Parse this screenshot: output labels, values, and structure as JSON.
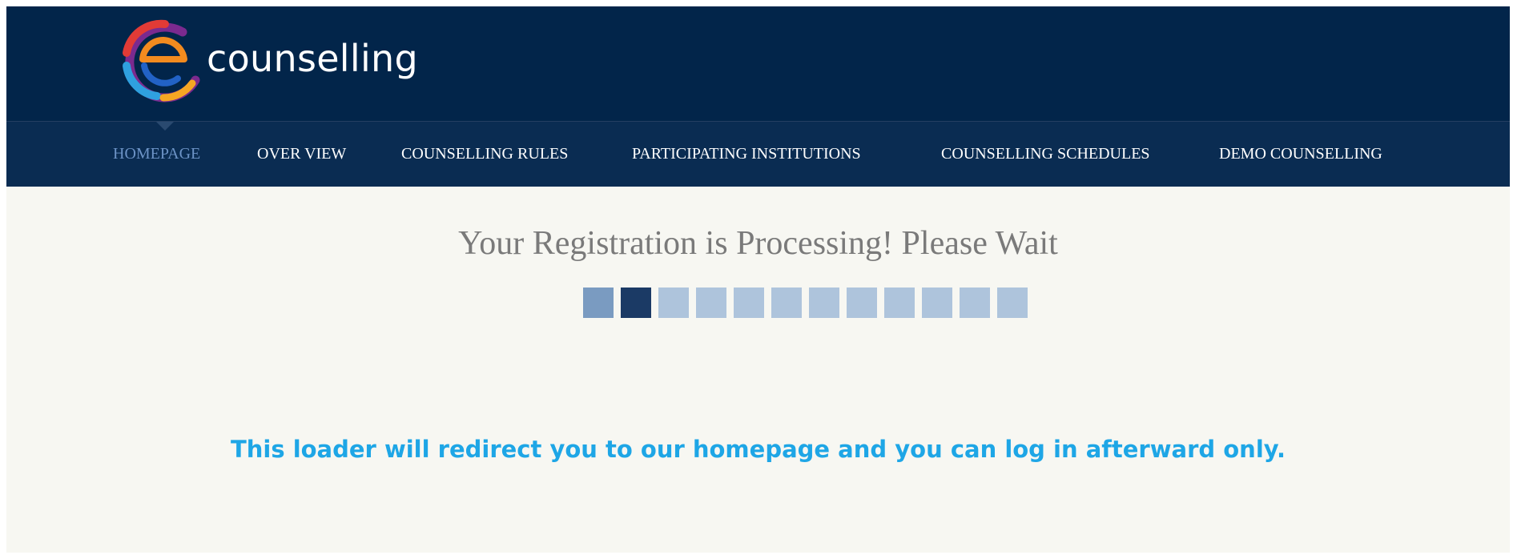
{
  "brand": {
    "name": "counselling",
    "logo_icon": "swirl-e-logo-icon"
  },
  "nav": {
    "items": [
      {
        "label": "HOMEPAGE",
        "active": true
      },
      {
        "label": "OVER VIEW",
        "active": false
      },
      {
        "label": "COUNSELLING RULES",
        "active": false
      },
      {
        "label": "PARTICIPATING INSTITUTIONS",
        "active": false
      },
      {
        "label": "COUNSELLING SCHEDULES",
        "active": false
      },
      {
        "label": "DEMO COUNSELLING",
        "active": false
      }
    ]
  },
  "main": {
    "title": "Your Registration is Processing! Please Wait",
    "loader": {
      "total_blocks": 12,
      "completed_blocks": 1,
      "current_block": 2
    },
    "note": "This loader will redirect you to our homepage and you can log in afterward only."
  },
  "colors": {
    "header_bg": "#02254a",
    "nav_bg": "#0a2c52",
    "nav_active": "#6c93c6",
    "page_bg": "#f7f7f2",
    "note_text": "#1ea6e6",
    "loader_pending": "#aec4dc",
    "loader_done": "#7a9bc1",
    "loader_current": "#1b3a65"
  }
}
